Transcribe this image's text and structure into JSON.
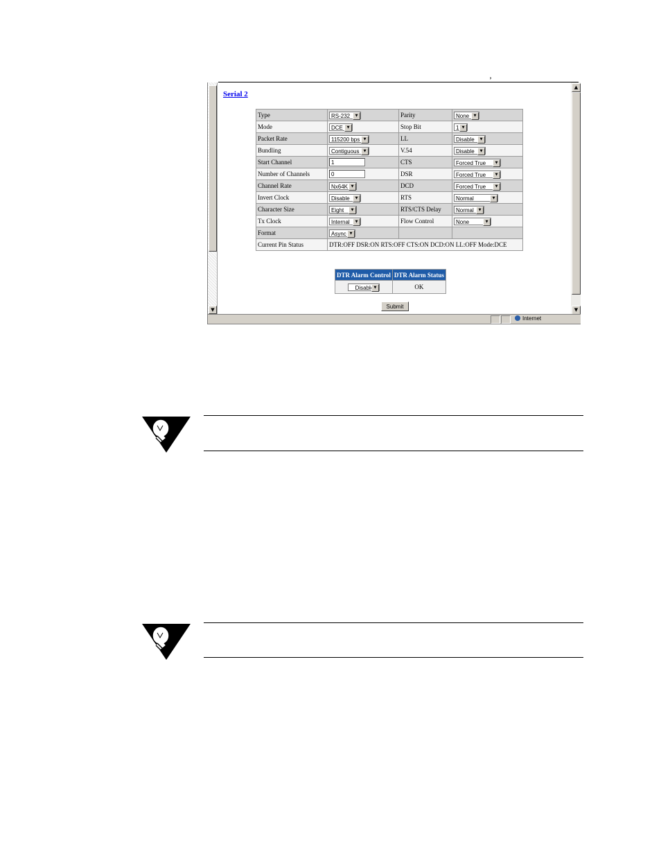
{
  "page": {
    "tick_mark": "’"
  },
  "form": {
    "title": "Serial 2",
    "rows": [
      {
        "l1": "Type",
        "v1": "RS-232",
        "k1": "select",
        "l2": "Parity",
        "v2": "None",
        "k2": "select"
      },
      {
        "l1": "Mode",
        "v1": "DCE",
        "k1": "select",
        "l2": "Stop Bit",
        "v2": "1",
        "k2": "select"
      },
      {
        "l1": "Packet Rate",
        "v1": "115200 bps",
        "k1": "select",
        "l2": "LL",
        "v2": "Disable",
        "k2": "select"
      },
      {
        "l1": "Bundling",
        "v1": "Contiguous",
        "k1": "select",
        "l2": "V.54",
        "v2": "Disable",
        "k2": "select"
      },
      {
        "l1": "Start Channel",
        "v1": "1",
        "k1": "input",
        "l2": "CTS",
        "v2": "Forced True",
        "k2": "select"
      },
      {
        "l1": "Number of Channels",
        "v1": "0",
        "k1": "input",
        "l2": "DSR",
        "v2": "Forced True",
        "k2": "select"
      },
      {
        "l1": "Channel Rate",
        "v1": "Nx64K",
        "k1": "select",
        "l2": "DCD",
        "v2": "Forced True",
        "k2": "select"
      },
      {
        "l1": "Invert Clock",
        "v1": "Disable",
        "k1": "select",
        "l2": "RTS",
        "v2": "Normal",
        "k2": "select"
      },
      {
        "l1": "Character Size",
        "v1": "Eight",
        "k1": "select",
        "l2": "RTS/CTS Delay",
        "v2": "Normal",
        "k2": "select"
      },
      {
        "l1": "Tx Clock",
        "v1": "Internal",
        "k1": "select",
        "l2": "Flow Control",
        "v2": "None",
        "k2": "select"
      },
      {
        "l1": "Format",
        "v1": "Async",
        "k1": "select",
        "l2": "",
        "v2": "",
        "k2": "none"
      }
    ],
    "pin_status_label": "Current Pin Status",
    "pin_status_value": "DTR:OFF DSR:ON RTS:OFF CTS:ON DCD:ON LL:OFF Mode:DCE",
    "dtr_alarm_control_header": "DTR Alarm Control",
    "dtr_alarm_status_header": "DTR Alarm Status",
    "dtr_alarm_control_value": "Disable",
    "dtr_alarm_status_value": "OK",
    "submit_label": "Submit"
  },
  "statusbar": {
    "zone": "Internet"
  },
  "icons": {
    "note": "lightbulb-icon"
  },
  "colors": {
    "header_blue": "#1e5ba8",
    "link_blue": "#0000ee"
  }
}
